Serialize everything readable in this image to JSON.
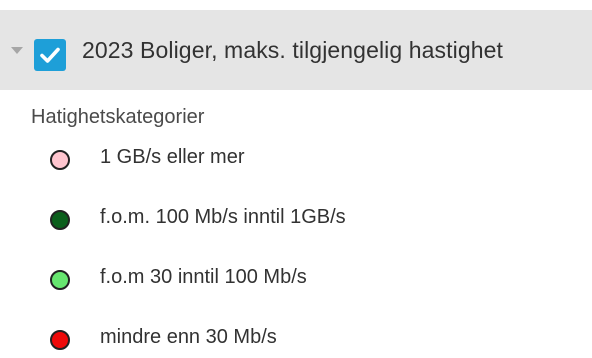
{
  "layer": {
    "title": "2023 Boliger, maks. tilgjengelig hastighet",
    "checked": true,
    "expanded": true,
    "checkbox_color": "#1e9fd8",
    "toggle_icon": "caret-down-icon",
    "checkbox_icon": "checkmark-icon"
  },
  "legend": {
    "heading": "Hatighetskategorier",
    "items": [
      {
        "label": "1 GB/s eller mer",
        "color": "#ffc5cf"
      },
      {
        "label": "f.o.m. 100 Mb/s inntil 1GB/s",
        "color": "#0b5f1c"
      },
      {
        "label": "f.o.m 30 inntil 100 Mb/s",
        "color": "#66e66f"
      },
      {
        "label": "mindre enn 30 Mb/s",
        "color": "#ee0a0a"
      }
    ]
  }
}
